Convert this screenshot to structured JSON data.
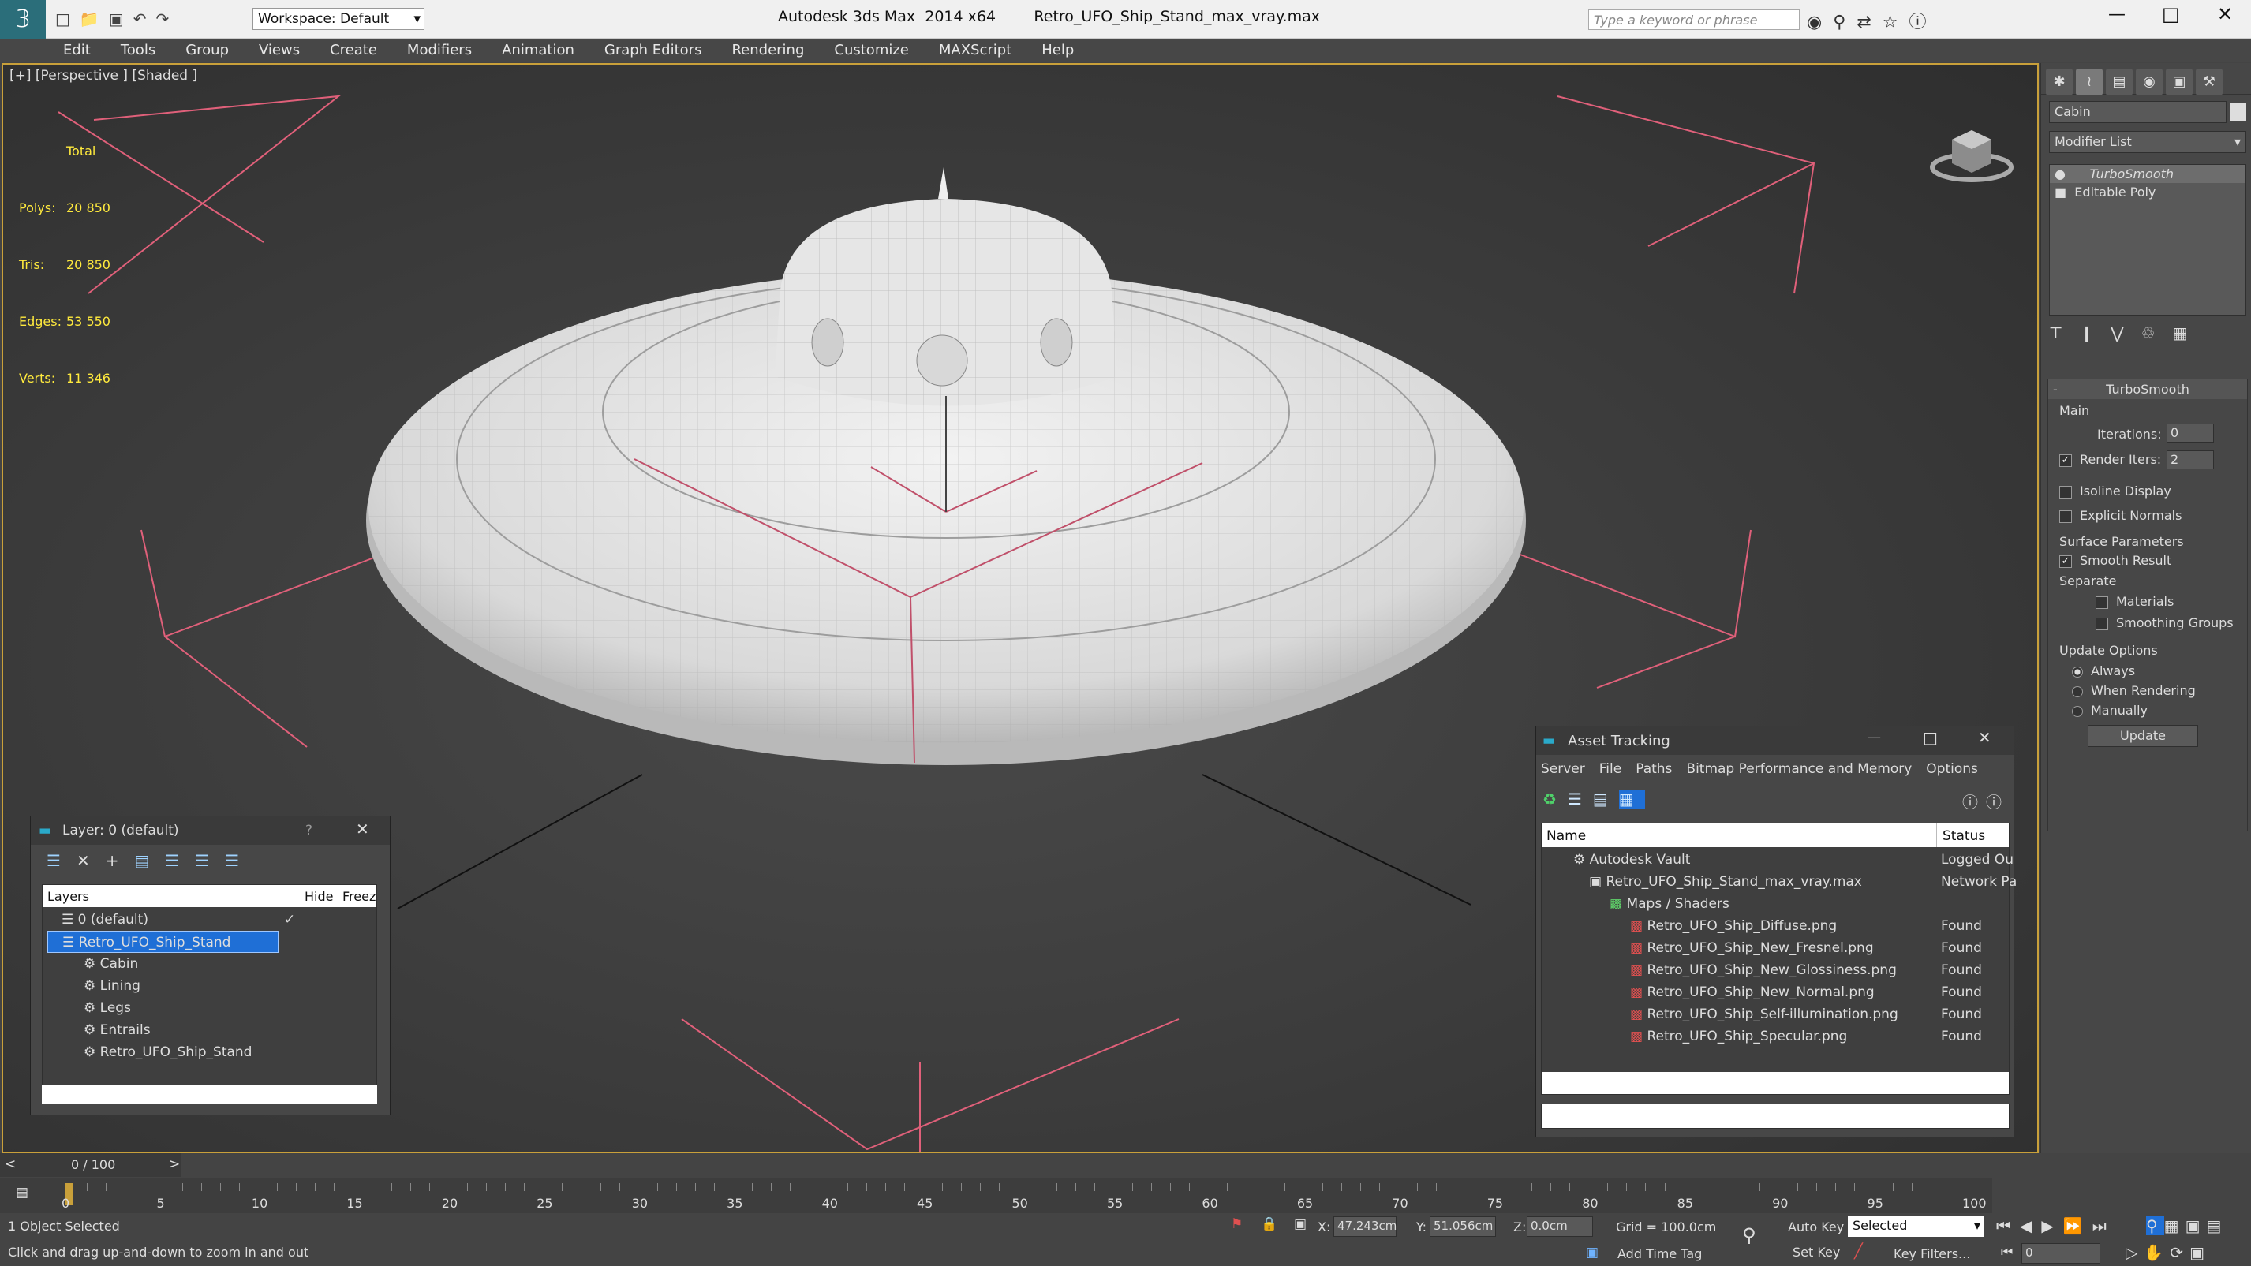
{
  "title": {
    "app": "Autodesk 3ds Max  2014 x64",
    "file": "Retro_UFO_Ship_Stand_max_vray.max",
    "workspace": "Workspace: Default",
    "search_placeholder": "Type a keyword or phrase"
  },
  "menu": [
    "Edit",
    "Tools",
    "Group",
    "Views",
    "Create",
    "Modifiers",
    "Animation",
    "Graph Editors",
    "Rendering",
    "Customize",
    "MAXScript",
    "Help"
  ],
  "viewport": {
    "label": "[+] [Perspective ] [Shaded ]",
    "stats": {
      "header": "Total",
      "polys_label": "Polys:",
      "polys": "20 850",
      "tris_label": "Tris:",
      "tris": "20 850",
      "edges_label": "Edges:",
      "edges": "53 550",
      "verts_label": "Verts:",
      "verts": "11 346"
    }
  },
  "command_panel": {
    "object_name": "Cabin",
    "modifier_list": "Modifier List",
    "stack": [
      "TurboSmooth",
      "Editable Poly"
    ],
    "rollout_title": "TurboSmooth",
    "main_label": "Main",
    "iterations_label": "Iterations:",
    "iterations": "0",
    "render_iters_label": "Render Iters:",
    "render_iters": "2",
    "isoline": "Isoline Display",
    "explicit": "Explicit Normals",
    "surface_params": "Surface Parameters",
    "smooth_result": "Smooth Result",
    "separate": "Separate",
    "materials": "Materials",
    "smoothing_groups": "Smoothing Groups",
    "update_options": "Update Options",
    "always": "Always",
    "when_rendering": "When Rendering",
    "manually": "Manually",
    "update": "Update"
  },
  "layer_window": {
    "title": "Layer: 0 (default)",
    "help": "?",
    "columns": {
      "layers": "Layers",
      "hide": "Hide",
      "freeze": "Freez"
    },
    "rows": [
      {
        "name": "0 (default)"
      },
      {
        "name": "Retro_UFO_Ship_Stand"
      },
      {
        "name": "Cabin"
      },
      {
        "name": "Lining"
      },
      {
        "name": "Legs"
      },
      {
        "name": "Entrails"
      },
      {
        "name": "Retro_UFO_Ship_Stand"
      }
    ]
  },
  "asset_window": {
    "title": "Asset Tracking",
    "menu": [
      "Server",
      "File",
      "Paths",
      "Bitmap Performance and Memory",
      "Options"
    ],
    "columns": {
      "name": "Name",
      "status": "Status"
    },
    "rows": [
      {
        "name": "Autodesk Vault",
        "status": "Logged Ou"
      },
      {
        "name": "Retro_UFO_Ship_Stand_max_vray.max",
        "status": "Network Pa"
      },
      {
        "name": "Maps / Shaders",
        "status": ""
      },
      {
        "name": "Retro_UFO_Ship_Diffuse.png",
        "status": "Found"
      },
      {
        "name": "Retro_UFO_Ship_New_Fresnel.png",
        "status": "Found"
      },
      {
        "name": "Retro_UFO_Ship_New_Glossiness.png",
        "status": "Found"
      },
      {
        "name": "Retro_UFO_Ship_New_Normal.png",
        "status": "Found"
      },
      {
        "name": "Retro_UFO_Ship_Self-illumination.png",
        "status": "Found"
      },
      {
        "name": "Retro_UFO_Ship_Specular.png",
        "status": "Found"
      }
    ]
  },
  "timeline": {
    "frame": "0 / 100",
    "ticks": [
      "0",
      "5",
      "10",
      "15",
      "20",
      "25",
      "30",
      "35",
      "40",
      "45",
      "50",
      "55",
      "60",
      "65",
      "70",
      "75",
      "80",
      "85",
      "90",
      "95",
      "100"
    ]
  },
  "status": {
    "selected": "1 Object Selected",
    "prompt": "Click and drag up-and-down to zoom in and out",
    "x_label": "X:",
    "x": "47.243cm",
    "y_label": "Y:",
    "y": "51.056cm",
    "z_label": "Z:",
    "z": "0.0cm",
    "grid": "Grid = 100.0cm",
    "add_time_tag": "Add Time Tag",
    "auto_key": "Auto Key",
    "set_key": "Set Key",
    "selected_dropdown": "Selected",
    "key_filters": "Key Filters...",
    "frame_field": "0"
  }
}
